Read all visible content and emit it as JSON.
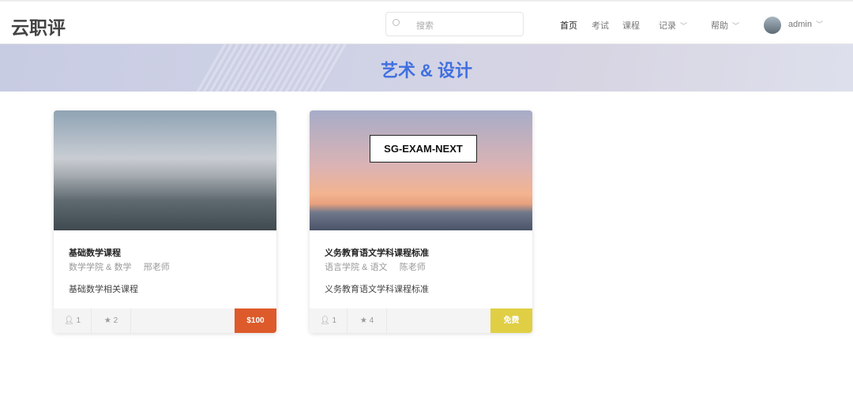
{
  "header": {
    "logo": "云职评",
    "search_placeholder": "搜索",
    "nav": [
      "首页",
      "考试",
      "课程",
      "记录",
      "帮助"
    ],
    "user": "admin"
  },
  "banner": {
    "title": "艺术 & 设计"
  },
  "courses": [
    {
      "title": "基础数学课程",
      "category": "数学学院 & 数学",
      "teacher": "邢老师",
      "description": "基础数学相关课程",
      "students": "1",
      "stars": "2",
      "price": "$100",
      "price_color": "#dd5a2b"
    },
    {
      "title": "义务教育语文学科课程标准",
      "category": "语言学院 & 语文",
      "teacher": "陈老师",
      "description": "义务教育语文学科课程标准",
      "students": "1",
      "stars": "4",
      "price": "免费",
      "price_color": "#e0cf45",
      "image_tag": "SG-EXAM-NEXT"
    }
  ]
}
